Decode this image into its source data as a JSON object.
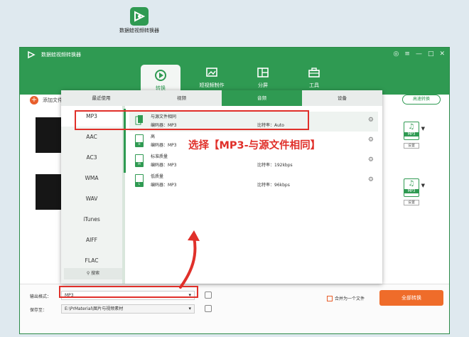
{
  "desktop_icon": {
    "label": "数据蛙视频转换器",
    "icon": "video-converter-icon"
  },
  "window": {
    "title": "数据蛙视频转换器",
    "controls": [
      "◎",
      "≡",
      "—",
      "□",
      "✕"
    ]
  },
  "nav": [
    {
      "label": "转换",
      "icon": "convert-icon",
      "active": true
    },
    {
      "label": "短视频制作",
      "icon": "short-video-icon"
    },
    {
      "label": "分屏",
      "icon": "split-screen-icon"
    },
    {
      "label": "工具",
      "icon": "toolbox-icon"
    }
  ],
  "toolbar": {
    "add_file": "添加文件",
    "speed_convert": "高速转换"
  },
  "output_badge": {
    "format": "MP3",
    "settings": "设置"
  },
  "panel": {
    "tabs": [
      {
        "label": "最近使用"
      },
      {
        "label": "视频"
      },
      {
        "label": "音频",
        "active": true
      },
      {
        "label": "设备"
      }
    ],
    "formats": [
      "MP3",
      "AAC",
      "AC3",
      "WMA",
      "WAV",
      "iTunes",
      "AIFF",
      "FLAC"
    ],
    "selected_format": "MP3",
    "search_label": "搜索",
    "options": [
      {
        "name": "与源文件相同",
        "encoder": "编码器：MP3",
        "bitrate": "比特率：Auto",
        "badge": ""
      },
      {
        "name": "高",
        "encoder": "编码器：MP3",
        "bitrate": "",
        "badge": "H"
      },
      {
        "name": "标准质量",
        "encoder": "编码器：MP3",
        "bitrate": "比特率：192kbps",
        "badge": "M"
      },
      {
        "name": "低质量",
        "encoder": "编码器：MP3",
        "bitrate": "比特率：96kbps",
        "badge": "L"
      }
    ]
  },
  "annotation": "选择【MP3-与源文件相同】",
  "footer": {
    "output_format_label": "输出格式：",
    "output_format_value": "MP3",
    "save_to_label": "保存至：",
    "save_to_value": "E:\\PrMaterial\\图片与视频素材",
    "merge_label": "合并为一个文件",
    "convert_all": "全部转换"
  },
  "colors": {
    "brand_green": "#2f9a52",
    "accent_orange": "#ef6c2a",
    "highlight_red": "#e0302a"
  }
}
